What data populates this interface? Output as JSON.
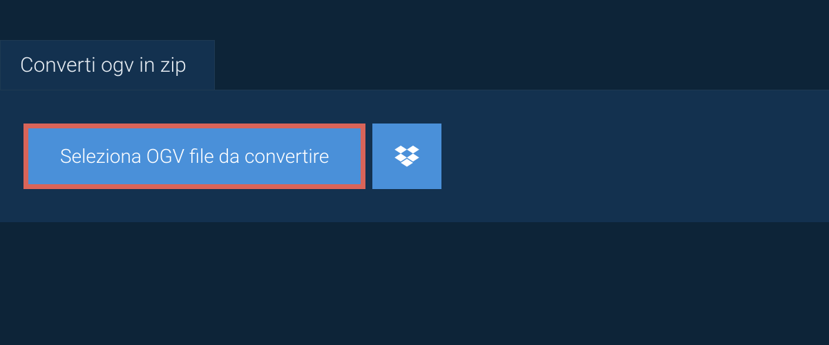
{
  "tab": {
    "title": "Converti ogv in zip"
  },
  "upload": {
    "select_label": "Seleziona OGV file da convertire"
  }
}
